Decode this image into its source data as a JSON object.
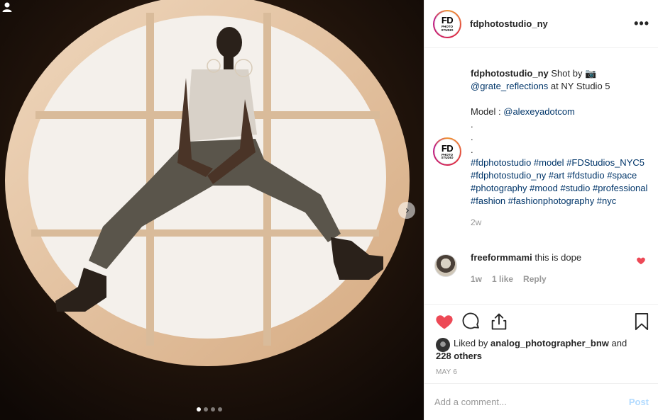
{
  "post": {
    "username": "fdphotostudio_ny",
    "more_label": "•••",
    "logo_text": "FD",
    "logo_sub": "PHOTO STUDIO"
  },
  "media": {
    "next_label": "›",
    "carousel_index": 1,
    "carousel_total": 4,
    "colors": {
      "background": "#130c07",
      "frame": "#e8c8a6",
      "window": "#f6f3ef"
    }
  },
  "caption": {
    "username": "fdphotostudio_ny",
    "line1": " Shot by 📷",
    "mention1": "@grate_reflections",
    "line1b": " at NY Studio 5",
    "model_label": "Model : ",
    "mention2": "@alexeyadotcom",
    "dots": ".",
    "hashtags": "#fdphotostudio #model #FDStudios_NYC5 #fdphotostudio_ny #art #fdstudio #space #photography #mood #studio #professional #fashion #fashionphotography #nyc",
    "time": "2w"
  },
  "comment": {
    "username": "freeformmami",
    "text": " this is dope",
    "time": "1w",
    "likes": "1 like",
    "reply": "Reply"
  },
  "likes": {
    "prefix": "Liked by ",
    "user": "analog_photographer_bnw",
    "mid": " and",
    "count": "228 others"
  },
  "date": "MAY 6",
  "add_comment": {
    "placeholder": "Add a comment...",
    "post_label": "Post"
  },
  "colors": {
    "heart": "#ed4956",
    "link": "#003569",
    "muted": "#999999",
    "post_disabled": "#b3dbff"
  }
}
